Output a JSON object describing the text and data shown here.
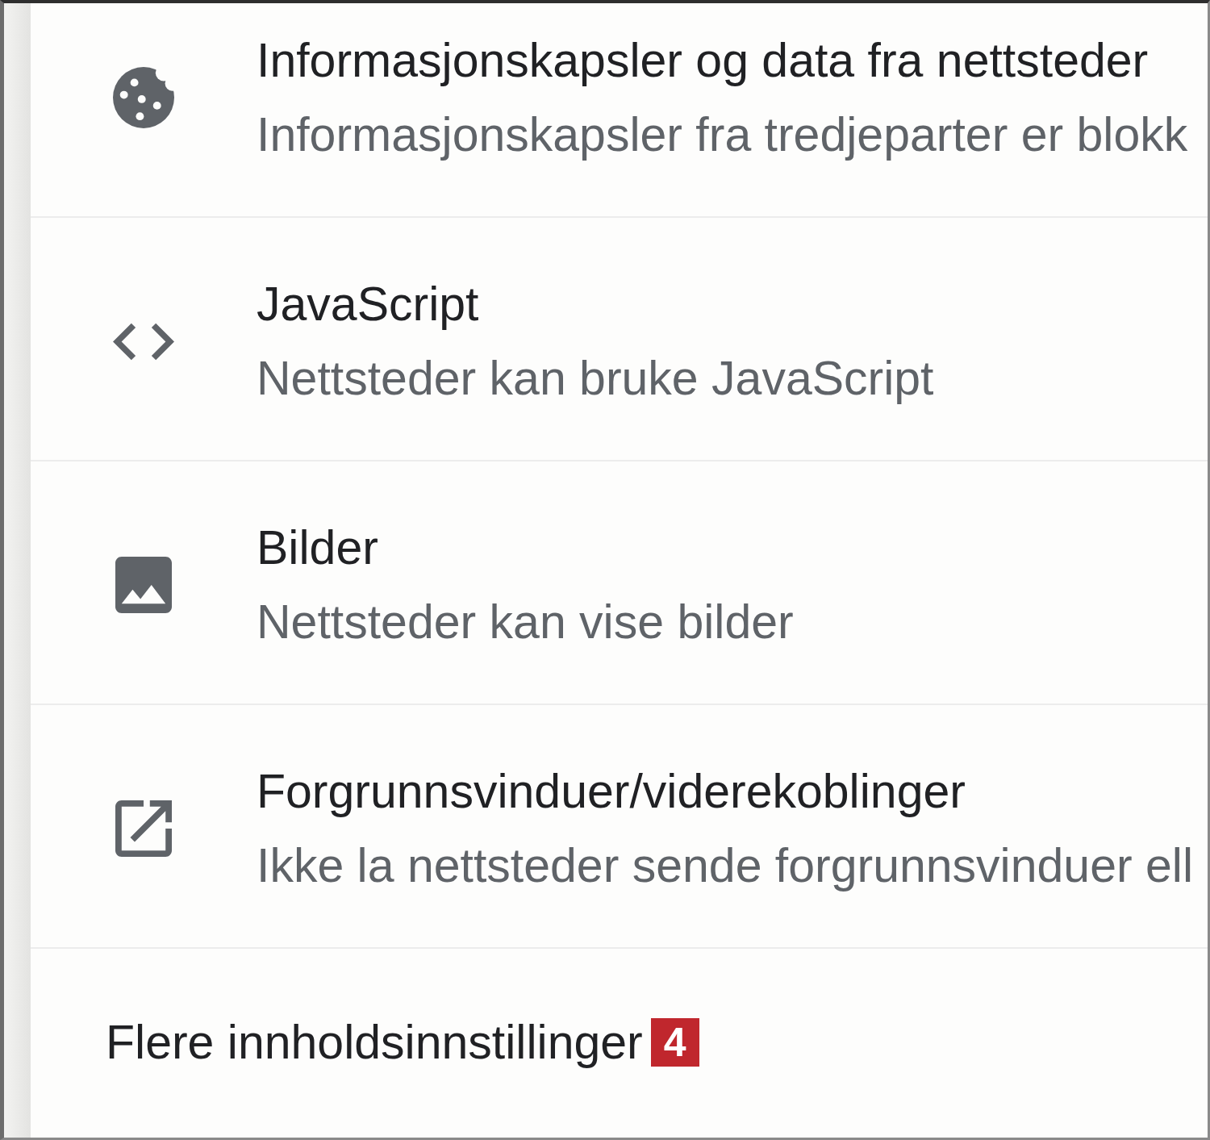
{
  "settings": [
    {
      "kind": "cookie",
      "title": "Informasjonskapsler og data fra nettsteder",
      "subtitle": "Informasjonskapsler fra tredjeparter er blokk"
    },
    {
      "kind": "code",
      "title": "JavaScript",
      "subtitle": "Nettsteder kan bruke JavaScript"
    },
    {
      "kind": "image",
      "title": "Bilder",
      "subtitle": "Nettsteder kan vise bilder"
    },
    {
      "kind": "popup",
      "title": "Forgrunnsvinduer/viderekoblinger",
      "subtitle": "Ikke la nettsteder sende forgrunnsvinduer ell"
    }
  ],
  "more_settings": {
    "label": "Flere innholdsinnstillinger",
    "badge": "4"
  }
}
